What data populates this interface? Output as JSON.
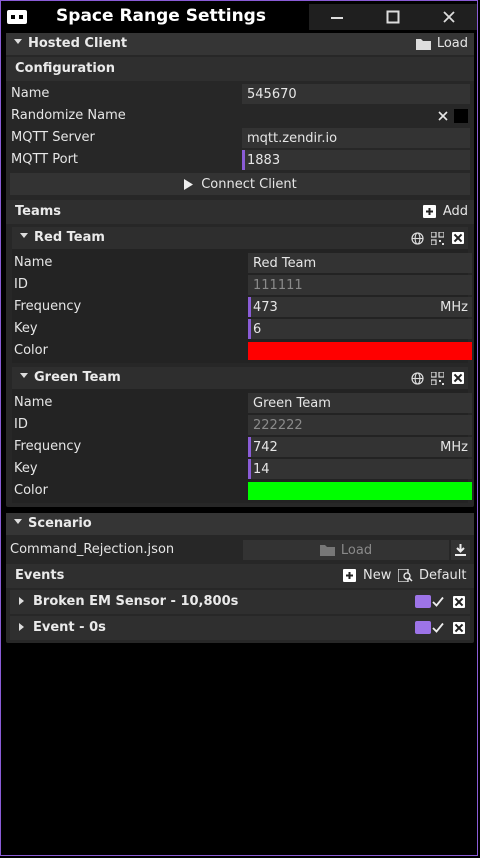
{
  "window": {
    "title": "Space Range Settings",
    "controls": {
      "minimize": "minimize",
      "maximize": "maximize",
      "close": "close"
    }
  },
  "hosted_client": {
    "header": "Hosted Client",
    "load_label": "Load",
    "configuration": {
      "header": "Configuration",
      "name_label": "Name",
      "name_value": "545670",
      "randomize_label": "Randomize Name",
      "mqtt_server_label": "MQTT Server",
      "mqtt_server_value": "mqtt.zendir.io",
      "mqtt_port_label": "MQTT Port",
      "mqtt_port_value": "1883",
      "connect_label": "Connect Client"
    },
    "teams": {
      "header": "Teams",
      "add_label": "Add",
      "items": [
        {
          "name": "Red Team",
          "name_label": "Name",
          "name_value": "Red Team",
          "id_label": "ID",
          "id_value": "111111",
          "frequency_label": "Frequency",
          "frequency_value": "473",
          "frequency_unit": "MHz",
          "key_label": "Key",
          "key_value": "6",
          "color_label": "Color",
          "color": "#ff0000"
        },
        {
          "name": "Green Team",
          "name_label": "Name",
          "name_value": "Green Team",
          "id_label": "ID",
          "id_value": "222222",
          "frequency_label": "Frequency",
          "frequency_value": "742",
          "frequency_unit": "MHz",
          "key_label": "Key",
          "key_value": "14",
          "color_label": "Color",
          "color": "#00ff00"
        }
      ]
    }
  },
  "scenario": {
    "header": "Scenario",
    "file": "Command_Rejection.json",
    "load_label": "Load",
    "events": {
      "header": "Events",
      "new_label": "New",
      "default_label": "Default",
      "items": [
        {
          "label": "Broken EM Sensor - 10,800s"
        },
        {
          "label": "Event - 0s"
        }
      ]
    }
  },
  "colors": {
    "accent": "#8a5cd6"
  }
}
